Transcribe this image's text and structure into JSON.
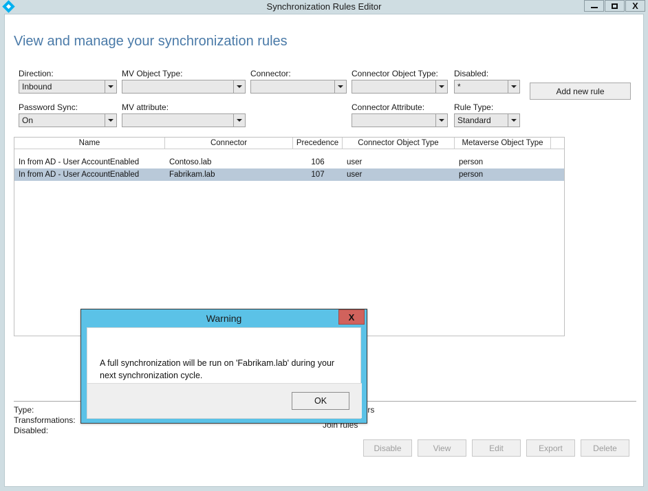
{
  "window": {
    "title": "Synchronization Rules Editor",
    "app_icon": "sync-diamond-icon",
    "minimize_label": "–",
    "maximize_label": "□",
    "close_label": "X"
  },
  "page": {
    "heading": "View and manage your synchronization rules"
  },
  "filters": [
    {
      "label": "Direction:",
      "value": "Inbound",
      "name": "direction"
    },
    {
      "label": "MV Object Type:",
      "value": "",
      "name": "mv-object-type"
    },
    {
      "label": "Connector:",
      "value": "",
      "name": "connector"
    },
    {
      "label": "Connector Object Type:",
      "value": "",
      "name": "connector-object-type"
    },
    {
      "label": "Disabled:",
      "value": "*",
      "name": "disabled"
    },
    {
      "label": "Password Sync:",
      "value": "On",
      "name": "password-sync"
    },
    {
      "label": "MV attribute:",
      "value": "",
      "name": "mv-attribute"
    },
    {
      "label": "Connector Attribute:",
      "value": "",
      "name": "connector-attribute"
    },
    {
      "label": "Rule Type:",
      "value": "Standard",
      "name": "rule-type"
    }
  ],
  "toolbar": {
    "add_new_rule_label": "Add new rule"
  },
  "table": {
    "columns": [
      "Name",
      "Connector",
      "Precedence",
      "Connector Object Type",
      "Metaverse Object Type"
    ],
    "rows": [
      {
        "name": "In from AD - User AccountEnabled",
        "connector": "Contoso.lab",
        "precedence": "106",
        "connector_object_type": "user",
        "metaverse_object_type": "person",
        "selected": false
      },
      {
        "name": "In from AD - User AccountEnabled",
        "connector": "Fabrikam.lab",
        "precedence": "107",
        "connector_object_type": "user",
        "metaverse_object_type": "person",
        "selected": true
      }
    ]
  },
  "detail": {
    "type_label": "Type:",
    "transformations_label": "Transformations:",
    "disabled_label": "Disabled:",
    "scoping_filters_label": "Scoping filters",
    "join_rules_label": "Join rules"
  },
  "actions": [
    {
      "label": "Disable",
      "name": "disable",
      "disabled": true
    },
    {
      "label": "View",
      "name": "view",
      "disabled": true
    },
    {
      "label": "Edit",
      "name": "edit",
      "disabled": true
    },
    {
      "label": "Export",
      "name": "export",
      "disabled": true
    },
    {
      "label": "Delete",
      "name": "delete",
      "disabled": true
    }
  ],
  "dialog": {
    "title": "Warning",
    "close_label": "X",
    "message": "A full synchronization will be run on 'Fabrikam.lab' during your next synchronization cycle.",
    "ok_label": "OK"
  },
  "colors": {
    "titlebar": "#cfdde2",
    "heading": "#4a7aa8",
    "dialog_border": "#5bc2e7",
    "dialog_close": "#d1625c",
    "row_selected": "#b9c9d9",
    "accent_icon": "#00b0f0"
  }
}
